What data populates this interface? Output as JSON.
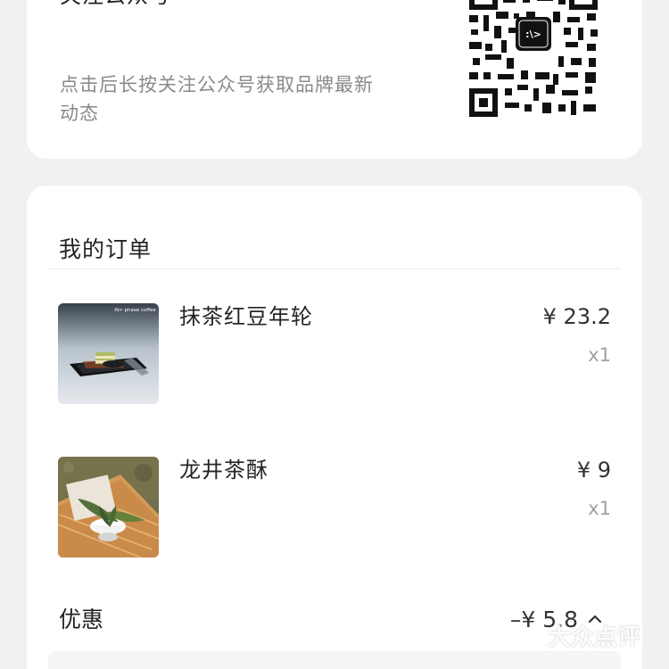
{
  "follow_card": {
    "title": "关注公众号",
    "description": "点击后长按关注公众号获取品牌最新动态"
  },
  "orders": {
    "title": "我的订单",
    "items": [
      {
        "name": "抹茶红豆年轮",
        "price": "¥ 23.2",
        "quantity": "x1",
        "image_caption": ":N> phase coffee"
      },
      {
        "name": "龙井茶酥",
        "price": "¥ 9",
        "quantity": "x1"
      }
    ],
    "discount": {
      "label": "优惠",
      "value": "–¥ 5.8"
    }
  },
  "watermark": {
    "text": "大众点评"
  },
  "icons": {
    "qr": "qr-code-icon",
    "chevron": "chevron-up-icon",
    "watermark": "dianping-logo-icon"
  }
}
